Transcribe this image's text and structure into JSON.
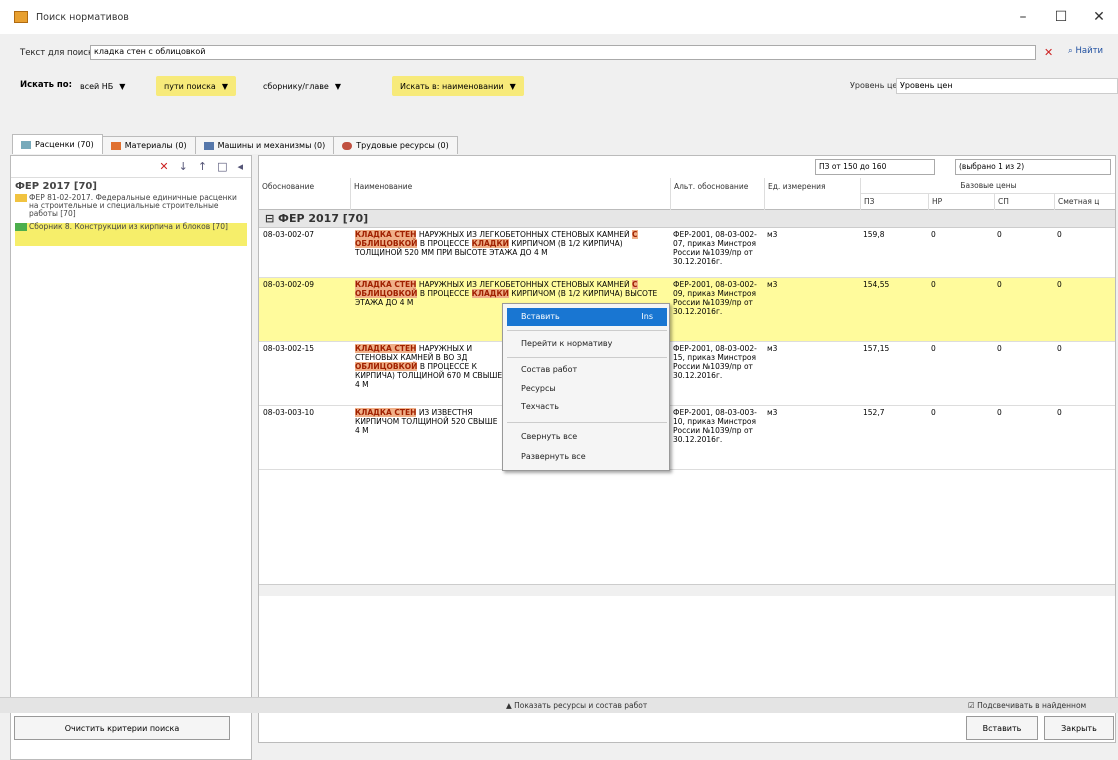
{
  "window": {
    "title": "Поиск нормативов",
    "min": "–",
    "max": "☐",
    "close": "✕"
  },
  "search": {
    "label": "Текст для поиска:",
    "value": "кладка стен с облицовкой",
    "find": "Найти"
  },
  "filters": {
    "label": "Искать по:",
    "base": "всей НБ",
    "paths": "пути поиска",
    "collections": "сборнику/главе",
    "name": "Искать в: наименовании",
    "price_label": "Уровень цен:",
    "price_value": "Уровень цен"
  },
  "tabs": [
    {
      "label": "Расценки (70)"
    },
    {
      "label": "Материалы (0)"
    },
    {
      "label": "Машины и механизмы (0)"
    },
    {
      "label": "Трудовые ресурсы (0)"
    }
  ],
  "tree": {
    "root": "ФЕР 2017 [70]",
    "nodes": [
      "ФЕР 81-02-2017. Федеральные единичные расценки на строительные и специальные строительные работы [70]",
      "Сборник 8. Конструкции из кирпича и блоков [70]"
    ]
  },
  "grid": {
    "range": "ПЗ от 150 до 160",
    "selected": "(выбрано 1 из 2)",
    "headers": {
      "code": "Обоснование",
      "name": "Наименование",
      "alt": "Альт. обоснование",
      "unit": "Ед. измерения",
      "base": "Базовые цены",
      "pz": "ПЗ",
      "nr": "НР",
      "sp": "СП",
      "est": "Сметная ц"
    },
    "group": "ФЕР 2017 [70]",
    "rows": [
      {
        "code": "08-03-002-07",
        "name1": "КЛАДКА СТЕН",
        "name2": "НАРУЖНЫХ ИЗ ЛЕГКОБЕТОННЫХ СТЕНОВЫХ КАМНЕЙ",
        "name3": "С ОБЛИЦОВКОЙ",
        "name4": "В ПРОЦЕССЕ",
        "name5": "КЛАДКИ",
        "name6": "КИРПИЧОМ (В 1/2 КИРПИЧА) ТОЛЩИНОЙ 520 ММ ПРИ ВЫСОТЕ ЭТАЖА ДО 4 М",
        "alt": "ФЕР-2001, 08-03-002-07, приказ Минстроя России №1039/пр от 30.12.2016г.",
        "unit": "м3",
        "pz": "159,8",
        "nr": "0",
        "sp": "0",
        "est": "0"
      },
      {
        "code": "08-03-002-09",
        "name1": "КЛАДКА СТЕН",
        "name2": "НАРУЖНЫХ ИЗ ЛЕГКОБЕТОННЫХ СТЕНОВЫХ КАМНЕЙ",
        "name3": "С ОБЛИЦОВКОЙ",
        "name4": "В ПРОЦЕССЕ",
        "name5": "КЛАДКИ",
        "name6": "КИРПИЧОМ (В 1/2 КИРПИЧА) ВЫСОТЕ ЭТАЖА ДО 4 М",
        "alt": "ФЕР-2001, 08-03-002-09, приказ Минстроя России №1039/пр от 30.12.2016г.",
        "unit": "м3",
        "pz": "154,55",
        "nr": "0",
        "sp": "0",
        "est": "0"
      },
      {
        "code": "08-03-002-15",
        "name1": "КЛАДКА СТЕН",
        "name2": "НАРУЖНЫХ И СТЕНОВЫХ КАМНЕЙ В ВО ЗД",
        "name3": "ОБЛИЦОВКОЙ",
        "name4": "В ПРОЦЕССЕ К",
        "name5": "",
        "name6": "КИРПИЧА) ТОЛЩИНОЙ 670 М СВЫШЕ 4 М",
        "alt": "ФЕР-2001, 08-03-002-15, приказ Минстроя России №1039/пр от 30.12.2016г.",
        "unit": "м3",
        "pz": "157,15",
        "nr": "0",
        "sp": "0",
        "est": "0"
      },
      {
        "code": "08-03-003-10",
        "name1": "КЛАДКА СТЕН",
        "name2": "ИЗ ИЗВЕСТНЯ",
        "name3": "",
        "name4": "",
        "name5": "",
        "name6": "КИРПИЧОМ ТОЛЩИНОЙ 520 СВЫШЕ 4 М",
        "alt": "ФЕР-2001, 08-03-003-10, приказ Минстроя России №1039/пр от 30.12.2016г.",
        "unit": "м3",
        "pz": "152,7",
        "nr": "0",
        "sp": "0",
        "est": "0"
      }
    ]
  },
  "context_menu": {
    "insert": "Вставить",
    "insert_key": "Ins",
    "goto": "Перейти к нормативу",
    "works": "Состав работ",
    "res": "Ресурсы",
    "tech": "Техчасть",
    "collapse": "Свернуть все",
    "expand": "Развернуть все"
  },
  "footer": {
    "show": "Показать ресурсы и состав работ",
    "highlight": "Подсвечивать в найденном",
    "clear": "Очистить критерии поиска",
    "insert": "Вставить",
    "close": "Закрыть"
  }
}
